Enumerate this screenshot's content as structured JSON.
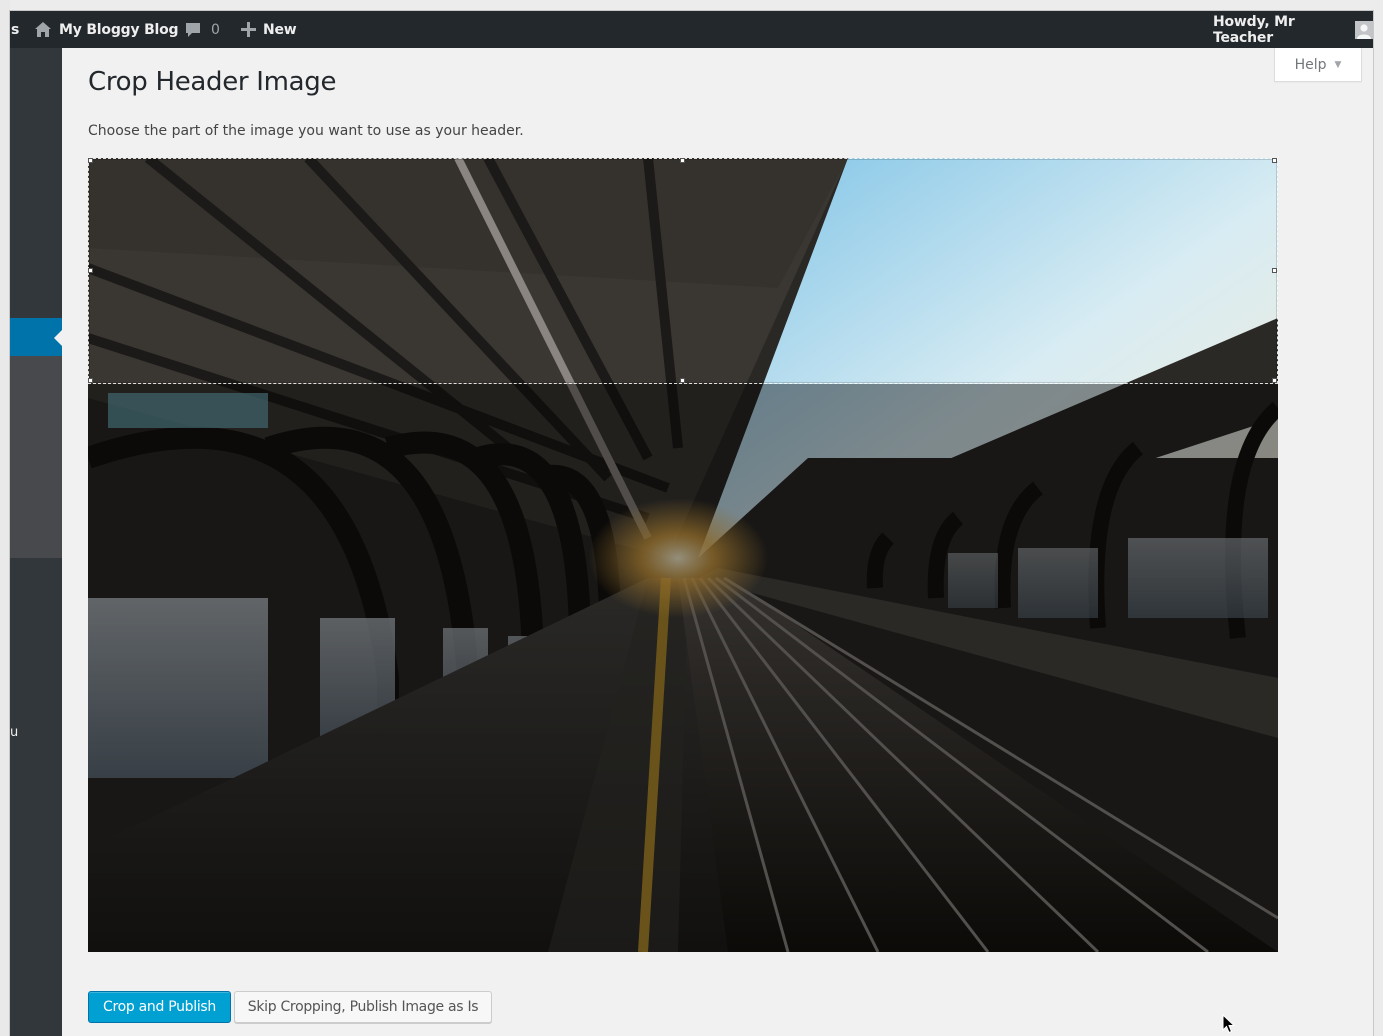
{
  "admin_bar": {
    "left_fragment": "s",
    "site_name": "My Bloggy Blog",
    "comments_count": "0",
    "new_label": "New",
    "howdy": "Howdy, Mr Teacher",
    "icons": {
      "home": "home-icon",
      "comments": "comment-bubble-icon",
      "new": "plus-icon",
      "avatar": "user-avatar-icon"
    }
  },
  "sidebar": {
    "menu_fragment": "u",
    "colors": {
      "background": "#32373c",
      "active": "#0073aa",
      "submenu": "#47494d"
    }
  },
  "help": {
    "label": "Help",
    "caret": "▼"
  },
  "page": {
    "title": "Crop Header Image",
    "description": "Choose the part of the image you want to use as your header."
  },
  "crop": {
    "image": "train-platform-photo",
    "selection_handles": 8
  },
  "buttons": {
    "crop_publish": "Crop and Publish",
    "skip": "Skip Cropping, Publish Image as Is"
  },
  "colors": {
    "primary_button": "#00a0d2",
    "admin_bar": "#23282d",
    "page_background": "#f1f1f1"
  }
}
